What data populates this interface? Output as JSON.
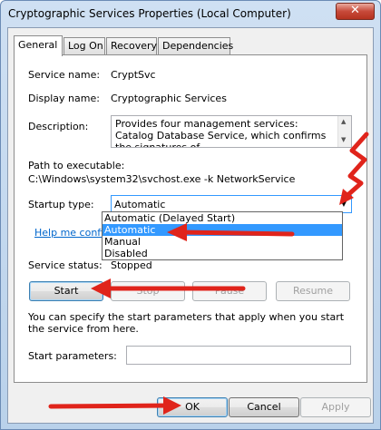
{
  "window": {
    "title": "Cryptographic Services Properties (Local Computer)",
    "close_glyph": "✕"
  },
  "tabs": [
    {
      "label": "General"
    },
    {
      "label": "Log On"
    },
    {
      "label": "Recovery"
    },
    {
      "label": "Dependencies"
    }
  ],
  "general": {
    "service_name_label": "Service name:",
    "service_name_value": "CryptSvc",
    "display_name_label": "Display name:",
    "display_name_value": "Cryptographic Services",
    "description_label": "Description:",
    "description_value": "Provides four management services: Catalog Database Service, which confirms the signatures of",
    "path_label": "Path to executable:",
    "path_value": "C:\\Windows\\system32\\svchost.exe -k NetworkService",
    "startup_type_label": "Startup type:",
    "startup_type_value": "Automatic",
    "startup_options": [
      {
        "label": "Automatic (Delayed Start)",
        "selected": false
      },
      {
        "label": "Automatic",
        "selected": true
      },
      {
        "label": "Manual",
        "selected": false
      },
      {
        "label": "Disabled",
        "selected": false
      }
    ],
    "help_link": "Help me configure",
    "service_status_label": "Service status:",
    "service_status_value": "Stopped",
    "start_button": "Start",
    "stop_button": "Stop",
    "pause_button": "Pause",
    "resume_button": "Resume",
    "note": "You can specify the start parameters that apply when you start the service from here.",
    "start_params_label": "Start parameters:",
    "start_params_value": ""
  },
  "footer": {
    "ok_button": "OK",
    "cancel_button": "Cancel",
    "apply_button": "Apply"
  },
  "colors": {
    "annotation_red": "#e0241b",
    "selection_blue": "#3399ff",
    "link_blue": "#0066cc"
  }
}
